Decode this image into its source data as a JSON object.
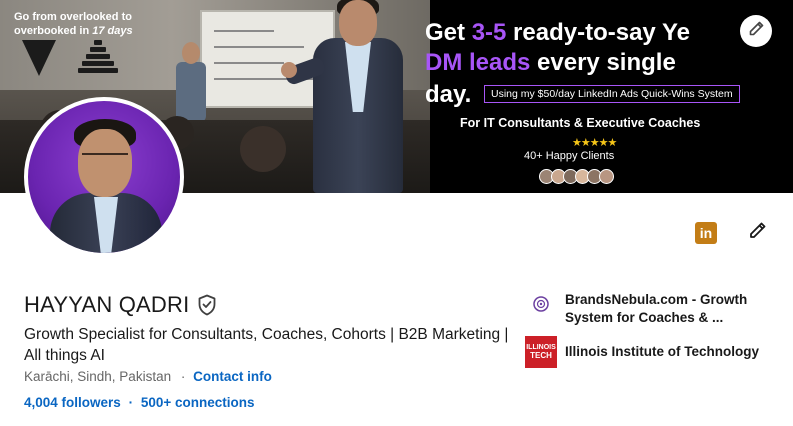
{
  "banner": {
    "overlay_line1": "Go from overlooked to",
    "overlay_line2_prefix": "overbooked in ",
    "overlay_line2_accent": "17 days",
    "promo": {
      "line1_prefix": "Get ",
      "line1_highlight": "3-5",
      "line1_suffix": " ready-to-say Ye",
      "line2_highlight": "DM leads",
      "line2_suffix": " every single",
      "line3": "day.",
      "subtitle": "Using my $50/day LinkedIn Ads Quick-Wins System",
      "audience": "For IT Consultants & Executive Coaches",
      "stars": "★★★★★",
      "clients": "40+ Happy Clients"
    },
    "accent_color": "#a855f7",
    "edit_icon": "pencil-icon"
  },
  "profile": {
    "name": "HAYYAN QADRI",
    "headline": "Growth Specialist for Consultants, Coaches, Cohorts | B2B Marketing | All things AI",
    "location": "Karāchi, Sindh, Pakistan",
    "location_separator": "·",
    "contact_info": "Contact info",
    "followers": "4,004 followers",
    "network_separator": "·",
    "connections": "500+ connections",
    "verified_icon": "verified-shield-icon"
  },
  "actions": {
    "linkedin_badge_label": "in",
    "edit_icon": "pencil-icon"
  },
  "positions": [
    {
      "name": "BrandsNebula.com - Growth System for Coaches & ...",
      "logo_label": "BRANDS NEBULA"
    },
    {
      "name": "Illinois Institute of Technology",
      "logo_label": "ILLINOIS TECH"
    }
  ],
  "colors": {
    "link": "#0a66c2",
    "text": "#191919",
    "muted": "#666666",
    "iit_red": "#cc2027",
    "linkedin_badge": "#c37d16"
  }
}
